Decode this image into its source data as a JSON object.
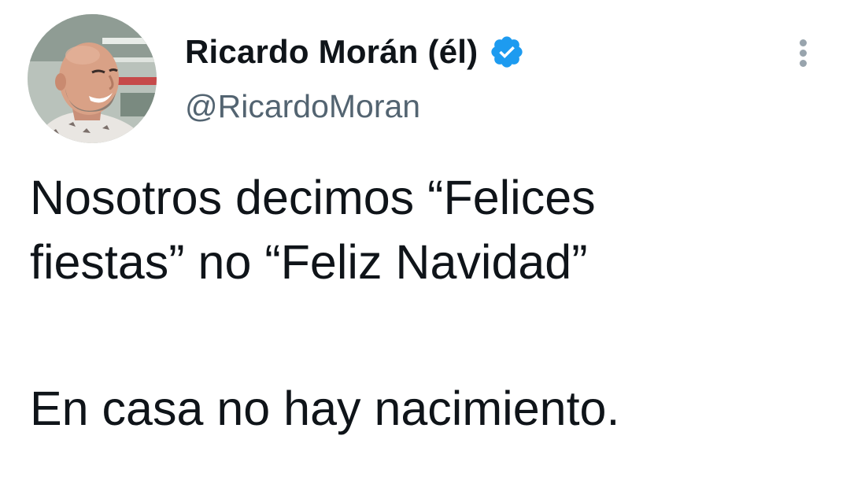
{
  "author": {
    "display_name": "Ricardo Morán (él)",
    "handle": "@RicardoMoran",
    "verified": true
  },
  "tweet": {
    "lines": [
      "Nosotros decimos “Felices",
      "fiestas” no “Feliz Navidad”"
    ],
    "line_after_break": "En casa no hay nacimiento."
  },
  "icons": {
    "verified": "verified-badge-icon",
    "more": "more-options-icon"
  },
  "colors": {
    "text": "#0f1419",
    "secondary_text": "#536471",
    "verified_blue": "#1d9bf0"
  }
}
